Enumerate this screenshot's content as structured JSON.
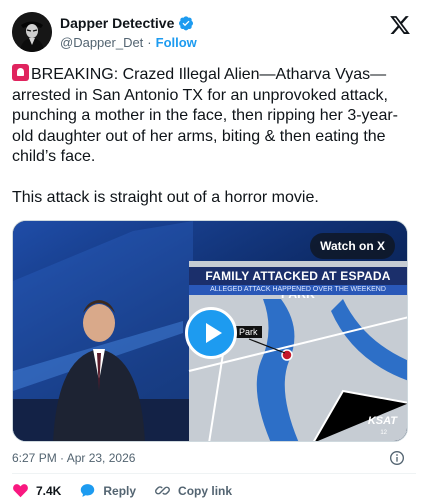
{
  "author": {
    "display_name": "Dapper Detective",
    "handle": "@Dapper_Det",
    "separator": "·",
    "follow_label": "Follow",
    "avatar_icon": "masked-figure-avatar",
    "verified_icon": "verified-badge-icon"
  },
  "platform_icon": "x-logo-icon",
  "tweet": {
    "paragraph_1": "BREAKING: Crazed Illegal Alien—Atharva Vyas—arrested in San Antonio TX for an unprovoked attack, punching a mother in the face, then ripping her 3-year-old daughter out of her arms, biting & then eating the child’s face.",
    "paragraph_2": "This attack is straight out of a horror movie.",
    "emoji_icon": "siren-emoji"
  },
  "media": {
    "watch_label": "Watch on X",
    "banner_title": "FAMILY ATTACKED AT ESPADA PARK",
    "banner_subtitle": "ALLEGED ATTACK HAPPENED OVER THE WEEKEND",
    "map_label": "Park",
    "station_logo": "KSAT",
    "channel": "12",
    "play_icon": "play-icon"
  },
  "footer": {
    "timestamp": "6:27 PM · Apr 23, 2026",
    "likes": "7.4K",
    "reply_label": "Reply",
    "copy_label": "Copy link"
  },
  "colors": {
    "accent": "#1d9bf0",
    "like": "#f91880",
    "text": "#0f1419",
    "muted": "#536471"
  }
}
